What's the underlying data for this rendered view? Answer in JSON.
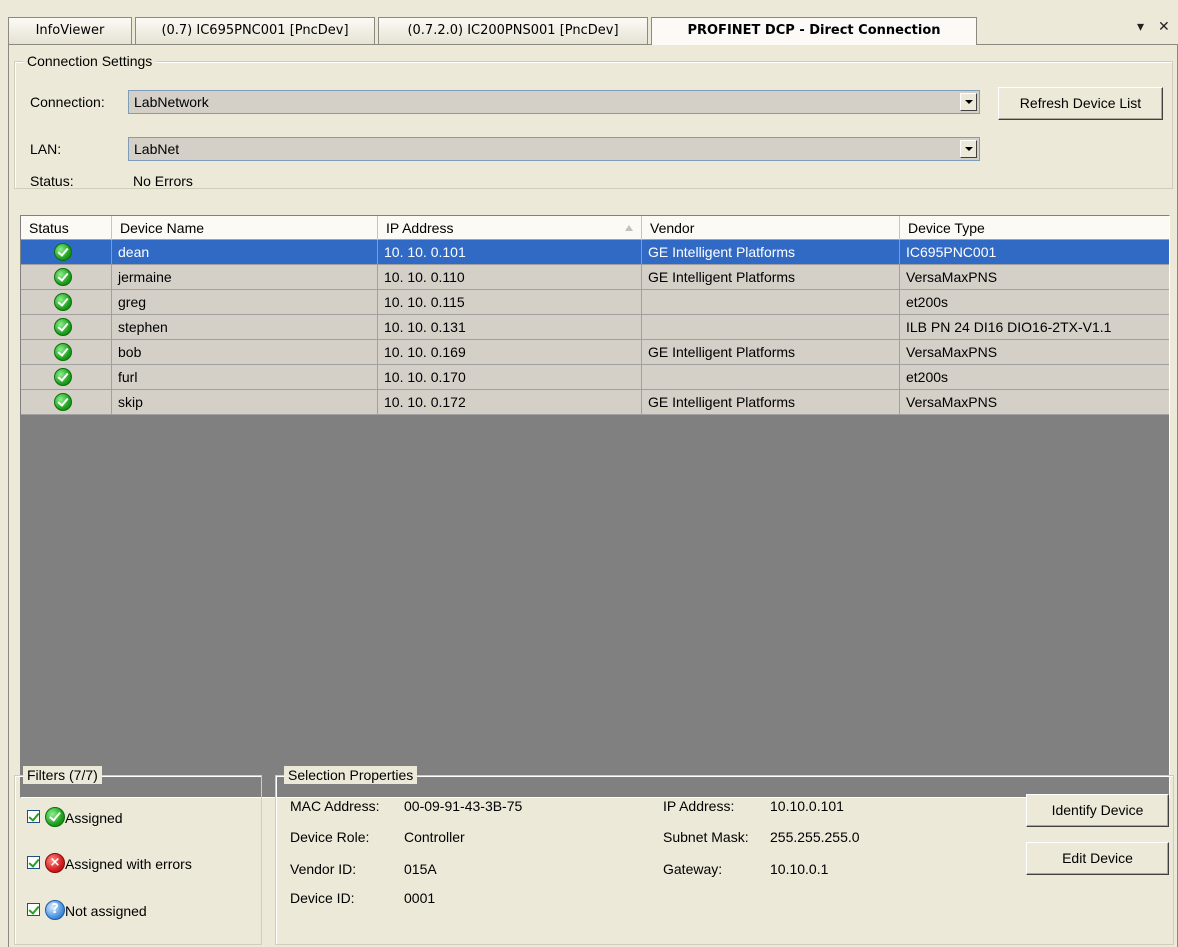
{
  "tabs": [
    {
      "label": "InfoViewer"
    },
    {
      "label": "(0.7) IC695PNC001 [PncDev]"
    },
    {
      "label": "(0.7.2.0) IC200PNS001 [PncDev]"
    },
    {
      "label": "PROFINET DCP - Direct Connection"
    }
  ],
  "tab_controls": {
    "pin": "▾",
    "close": "✕"
  },
  "connection_settings": {
    "title": "Connection Settings",
    "connection_label": "Connection:",
    "connection_value": "LabNetwork",
    "lan_label": "LAN:",
    "lan_value": "LabNet",
    "status_label": "Status:",
    "status_value": "No Errors",
    "refresh_button": "Refresh Device List"
  },
  "device_grid": {
    "columns": [
      "Status",
      "Device Name",
      "IP Address",
      "Vendor",
      "Device Type"
    ],
    "sorted_column": "IP Address",
    "selected_row": 0,
    "rows": [
      {
        "status": "assigned",
        "name": "dean",
        "ip": "10. 10.  0.101",
        "vendor": "GE Intelligent Platforms",
        "type": "IC695PNC001"
      },
      {
        "status": "assigned",
        "name": "jermaine",
        "ip": "10. 10.  0.110",
        "vendor": "GE Intelligent Platforms",
        "type": "VersaMaxPNS"
      },
      {
        "status": "assigned",
        "name": "greg",
        "ip": "10. 10.  0.115",
        "vendor": "",
        "type": "et200s"
      },
      {
        "status": "assigned",
        "name": "stephen",
        "ip": "10. 10.  0.131",
        "vendor": "",
        "type": "ILB PN 24 DI16 DIO16-2TX-V1.1"
      },
      {
        "status": "assigned",
        "name": "bob",
        "ip": "10. 10.  0.169",
        "vendor": "GE Intelligent Platforms",
        "type": "VersaMaxPNS"
      },
      {
        "status": "assigned",
        "name": "furl",
        "ip": "10. 10.  0.170",
        "vendor": "",
        "type": "et200s"
      },
      {
        "status": "assigned",
        "name": "skip",
        "ip": "10. 10.  0.172",
        "vendor": "GE Intelligent Platforms",
        "type": "VersaMaxPNS"
      }
    ]
  },
  "filters": {
    "title": "Filters  (7/7)",
    "items": [
      {
        "label": "Assigned",
        "checked": true,
        "icon": "check-circle-icon"
      },
      {
        "label": "Assigned with errors",
        "checked": true,
        "icon": "error-x-icon"
      },
      {
        "label": "Not assigned",
        "checked": true,
        "icon": "question-icon"
      }
    ]
  },
  "selection_properties": {
    "title": "Selection Properties",
    "mac_label": "MAC Address:",
    "mac_value": "00-09-91-43-3B-75",
    "role_label": "Device Role:",
    "role_value": "Controller",
    "vendor_id_label": "Vendor ID:",
    "vendor_id_value": "015A",
    "device_id_label": "Device ID:",
    "device_id_value": "0001",
    "ip_label": "IP Address:",
    "ip_value": "10.10.0.101",
    "subnet_label": "Subnet Mask:",
    "subnet_value": "255.255.255.0",
    "gateway_label": "Gateway:",
    "gateway_value": "10.10.0.1",
    "identify_button": "Identify Device",
    "edit_button": "Edit Device"
  },
  "colors": {
    "selection": "#316ac5",
    "grid_empty": "#808080",
    "row_bg": "#d4d0c8",
    "window_bg": "#ece9d8"
  }
}
